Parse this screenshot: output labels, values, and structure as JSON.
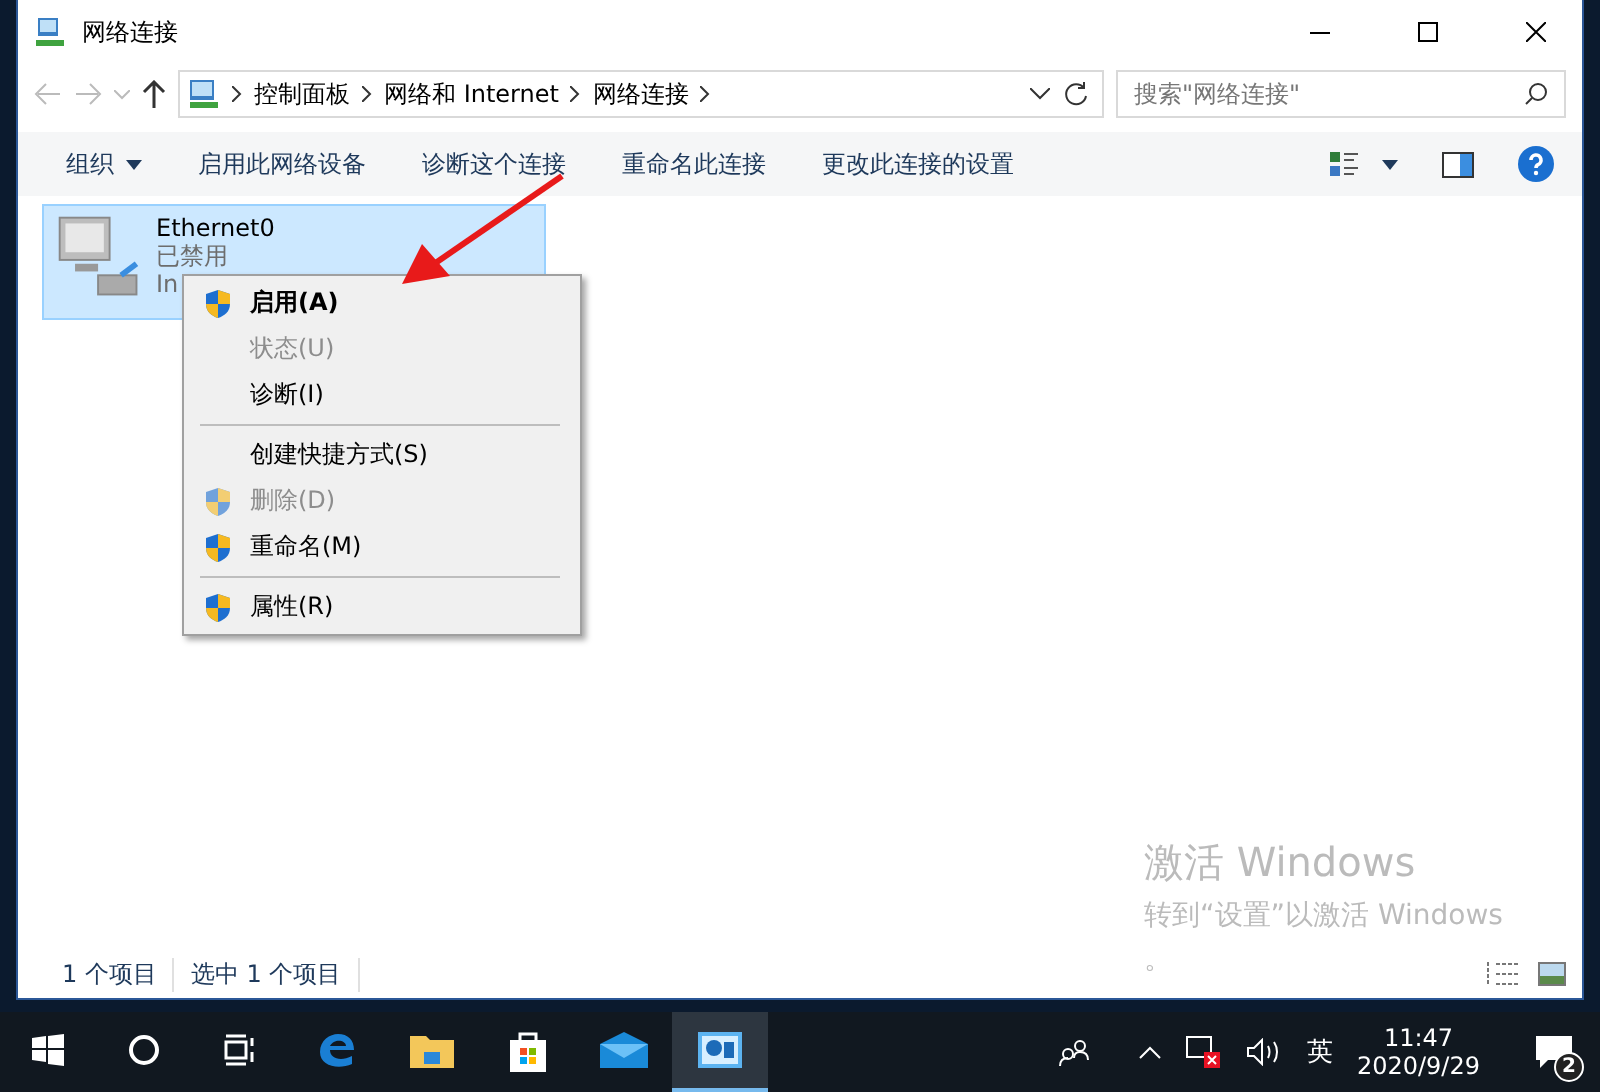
{
  "window": {
    "title": "网络连接"
  },
  "address": {
    "crumbs": [
      "控制面板",
      "网络和 Internet",
      "网络连接"
    ],
    "search_placeholder": "搜索\"网络连接\""
  },
  "commands": [
    "组织",
    "启用此网络设备",
    "诊断这个连接",
    "重命名此连接",
    "更改此连接的设置"
  ],
  "connections": [
    {
      "name": "Ethernet0",
      "status": "已禁用",
      "device": "In",
      "selected": true
    }
  ],
  "context_menu": {
    "items": [
      {
        "kind": "item",
        "label": "启用(A)",
        "shield": true,
        "disabled": false,
        "default": true
      },
      {
        "kind": "item",
        "label": "状态(U)",
        "shield": false,
        "disabled": true,
        "default": false
      },
      {
        "kind": "item",
        "label": "诊断(I)",
        "shield": false,
        "disabled": false,
        "default": false
      },
      {
        "kind": "separator"
      },
      {
        "kind": "item",
        "label": "创建快捷方式(S)",
        "shield": false,
        "disabled": false,
        "default": false
      },
      {
        "kind": "item",
        "label": "删除(D)",
        "shield": true,
        "disabled": true,
        "default": false
      },
      {
        "kind": "item",
        "label": "重命名(M)",
        "shield": true,
        "disabled": false,
        "default": false
      },
      {
        "kind": "separator"
      },
      {
        "kind": "item",
        "label": "属性(R)",
        "shield": true,
        "disabled": false,
        "default": false
      }
    ]
  },
  "activation": {
    "title": "激活 Windows",
    "line": "转到“设置”以激活 Windows",
    "tail": "。"
  },
  "status_bar": [
    "1 个项目",
    "选中 1 个项目"
  ],
  "taskbar": {
    "apps": [
      {
        "kind": "edge",
        "selected": false
      },
      {
        "kind": "folder",
        "selected": false
      },
      {
        "kind": "store",
        "selected": false
      },
      {
        "kind": "mail",
        "selected": false
      },
      {
        "kind": "panel",
        "selected": true
      }
    ],
    "language": "英",
    "time": "11:47",
    "date": "2020/9/29",
    "notifications": "2"
  }
}
